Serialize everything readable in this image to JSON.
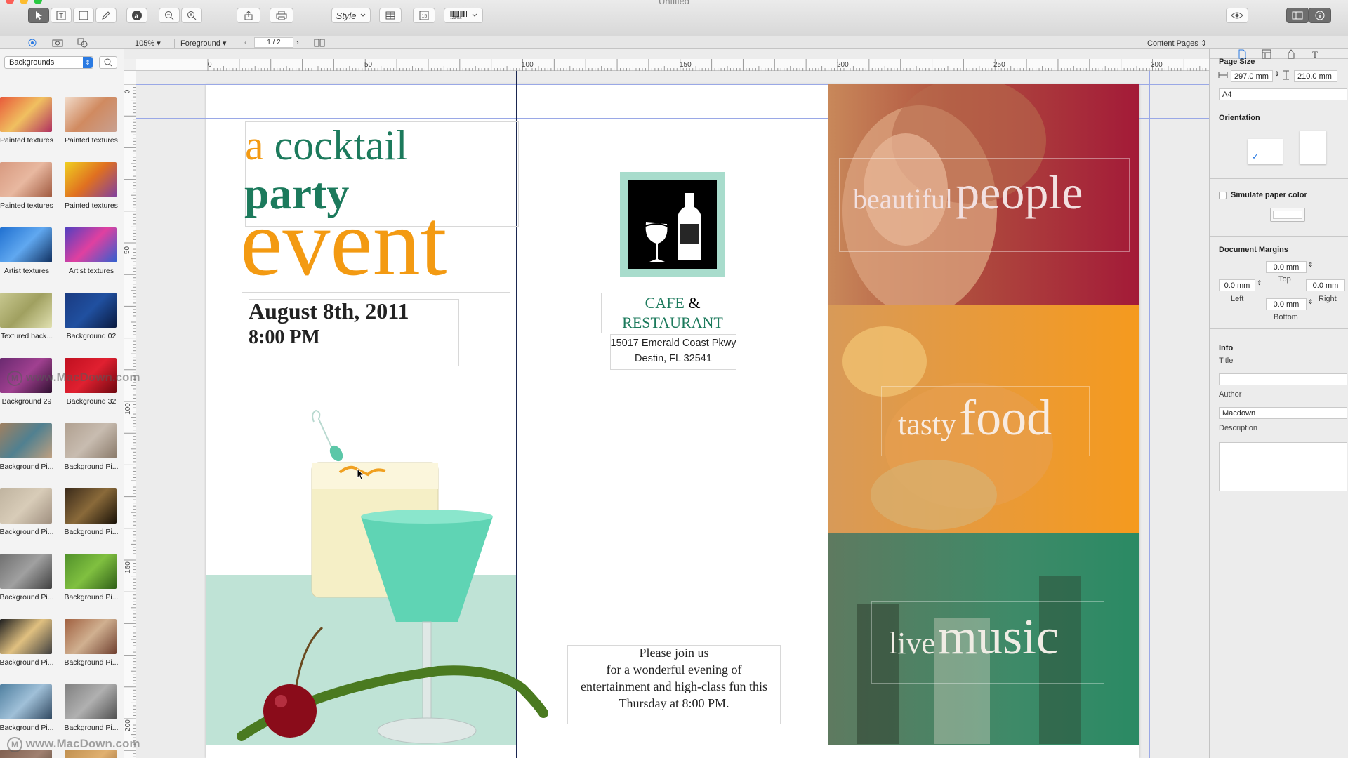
{
  "window": {
    "title": "Untitled"
  },
  "toolbar": {
    "style_label": "Style",
    "barcode_label": "123456"
  },
  "subbar": {
    "zoom": "105%",
    "layer": "Foreground",
    "page_indicator": "1 / 2",
    "content_pages": "Content Pages"
  },
  "library": {
    "category": "Backgrounds",
    "items": [
      {
        "label": "Painted textures",
        "colors": [
          "#e85a3a",
          "#f0c060",
          "#b03060"
        ]
      },
      {
        "label": "Painted textures",
        "colors": [
          "#f2dccb",
          "#d08a60",
          "#c9a090"
        ]
      },
      {
        "label": "Painted textures",
        "colors": [
          "#d89a80",
          "#e8b8a0",
          "#a05a40"
        ]
      },
      {
        "label": "Painted textures",
        "colors": [
          "#f0d020",
          "#e07020",
          "#8040a0"
        ]
      },
      {
        "label": "Artist textures",
        "colors": [
          "#2070d0",
          "#60a8f0",
          "#103060"
        ]
      },
      {
        "label": "Artist textures",
        "colors": [
          "#5040c0",
          "#e040a0",
          "#3060d0"
        ]
      },
      {
        "label": "Textured back...",
        "colors": [
          "#c8c890",
          "#a0a060",
          "#e0e0b0"
        ]
      },
      {
        "label": "Background 02",
        "colors": [
          "#1a3a80",
          "#2050a0",
          "#0a1a40"
        ]
      },
      {
        "label": "Background 29",
        "colors": [
          "#6a2a70",
          "#a04090",
          "#301030"
        ]
      },
      {
        "label": "Background 32",
        "colors": [
          "#c01020",
          "#e02030",
          "#700810"
        ]
      },
      {
        "label": "Background Pi...",
        "colors": [
          "#a08060",
          "#508090",
          "#c0a080"
        ]
      },
      {
        "label": "Background Pi...",
        "colors": [
          "#b0a090",
          "#c8bcb0",
          "#8a7a6a"
        ]
      },
      {
        "label": "Background Pi...",
        "colors": [
          "#c0b4a0",
          "#d8ccb8",
          "#a09080"
        ]
      },
      {
        "label": "Background Pi...",
        "colors": [
          "#3a2a1a",
          "#8a6a3a",
          "#1a1208"
        ]
      },
      {
        "label": "Background Pi...",
        "colors": [
          "#707070",
          "#a0a0a0",
          "#404040"
        ]
      },
      {
        "label": "Background Pi...",
        "colors": [
          "#50902a",
          "#80c040",
          "#306018"
        ]
      },
      {
        "label": "Background Pi...",
        "colors": [
          "#202020",
          "#e0c080",
          "#404040"
        ]
      },
      {
        "label": "Background Pi...",
        "colors": [
          "#a06040",
          "#d0b090",
          "#704030"
        ]
      },
      {
        "label": "Background Pi...",
        "colors": [
          "#5080a0",
          "#a0c0d8",
          "#304860"
        ]
      },
      {
        "label": "Background Pi...",
        "colors": [
          "#808080",
          "#b0b0b0",
          "#505050"
        ]
      },
      {
        "label": "",
        "colors": [
          "#806050",
          "#a08070",
          "#504030"
        ]
      },
      {
        "label": "",
        "colors": [
          "#c09050",
          "#e0b070",
          "#906030"
        ]
      }
    ]
  },
  "ruler": {
    "h_ticks": [
      "0",
      "50",
      "100",
      "150",
      "200",
      "250",
      "300"
    ],
    "v_ticks": [
      "0",
      "50",
      "100",
      "150",
      "200"
    ]
  },
  "document": {
    "headline_a": "a",
    "headline_cocktail": "cocktail",
    "headline_party": "party",
    "headline_event": "event",
    "date": "August 8th, 2011",
    "time": "8:00 PM",
    "venue_line1": "CAFE",
    "venue_amp": "&",
    "venue_line2": "RESTAURANT",
    "address_line1": "15017 Emerald Coast Pkwy",
    "address_line2": "Destin, FL 32541",
    "invite_line1": "Please join us",
    "invite_line2": "for a wonderful evening of",
    "invite_line3": "entertainment and high-class fun this",
    "invite_line4": "Thursday at 8:00 PM.",
    "panel1_small": "beautiful",
    "panel1_big": "people",
    "panel2_small": "tasty",
    "panel2_big": "food",
    "panel3_small": "live",
    "panel3_big": "music",
    "watermark": "www.MacDown.com",
    "colors": {
      "orange": "#f39a12",
      "green": "#1c7a5c",
      "mint": "#bfe3d6",
      "panel_red": "#a31a38",
      "panel_orange": "#f59a1e",
      "panel_green": "#2a8a64"
    }
  },
  "inspector": {
    "page_size_label": "Page Size",
    "width": "297.0 mm",
    "height": "210.0 mm",
    "paper": "A4",
    "orientation_label": "Orientation",
    "simulate_label": "Simulate paper color",
    "margins_label": "Document Margins",
    "margin_top": "0.0 mm",
    "margin_left": "0.0 mm",
    "margin_right": "0.0 mm",
    "margin_bottom": "0.0 mm",
    "top_label": "Top",
    "left_label": "Left",
    "right_label": "Right",
    "bottom_label": "Bottom",
    "info_label": "Info",
    "title_label": "Title",
    "title_value": "",
    "author_label": "Author",
    "author_value": "Macdown",
    "description_label": "Description"
  }
}
